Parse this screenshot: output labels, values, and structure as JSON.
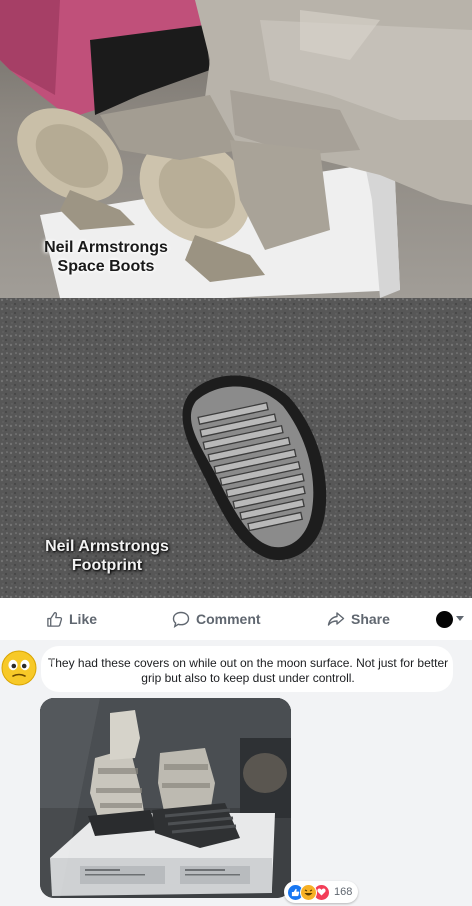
{
  "post": {
    "image_top_caption": "Neil Armstrongs\nSpace Boots",
    "image_bottom_caption": "Neil Armstrongs\nFootprint"
  },
  "actions": {
    "like": "Like",
    "comment": "Comment",
    "share": "Share"
  },
  "comment": {
    "prefix": "!",
    "text": "They had these covers on while out on the moon surface. Not just for better grip but also to keep dust under controll.",
    "reaction_count": "168",
    "reaction_icons": [
      "like-icon",
      "haha-icon",
      "love-icon"
    ]
  },
  "colors": {
    "action_text": "#606770",
    "comment_bg": "#f2f3f5",
    "like_blue": "#1877f2",
    "love_red": "#f33e58",
    "haha_yellow": "#f7b125"
  }
}
